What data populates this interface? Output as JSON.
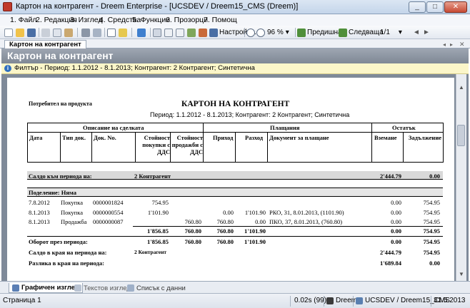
{
  "window": {
    "title": "Картон на контрагент - Dreem Enterprise - [UCSDEV / Dreem15_CMS (Dreem)]"
  },
  "menu": [
    "1. Файл",
    "2. Редакция",
    "3. Изглед",
    "4. Средства",
    "5. Функции",
    "6. Прозорци",
    "7. Помощ"
  ],
  "toolbar": {
    "settings_label": "Настройки...",
    "zoom": "96 %",
    "prev_label": "Предишна",
    "next_label": "Следваща",
    "page": "1/1"
  },
  "tab": {
    "label": "Картон на контрагент"
  },
  "header": {
    "title": "Картон на контрагент"
  },
  "filter": {
    "text": "Филтър - Период: 1.1.2012 - 8.1.2013; Контрагент: 2 Контрагент; Синтетична"
  },
  "report": {
    "consumer": "Потребител на продукта",
    "title": "КАРТОН НА КОНТРАГЕНТ",
    "subtitle": "Период: 1.1.2012 - 8.1.2013; Контрагент: 2 Контрагент; Синтетична",
    "group_headers": {
      "description": "Описание на сделката",
      "payments": "Плащания",
      "balances": "Остатък"
    },
    "columns": {
      "date": "Дата",
      "doc_type": "Тип док.",
      "doc_no": "Док. No.",
      "buy_value": "Стойност покупки с ДДС",
      "sell_value": "Стойност продажби с ДДС",
      "income": "Приход",
      "expense": "Разход",
      "payment_doc": "Документ за плащане",
      "receivable": "Вземане",
      "liability": "Задължение"
    },
    "opening": {
      "label": "Салдо към периода на:",
      "counterparty": "2 Контрагент",
      "receivable": "2'444.79",
      "liability": "0.00"
    },
    "division": "Поделение: Няма",
    "rows": [
      {
        "date": "7.8.2012",
        "type": "Покупка",
        "no": "0000001824",
        "buy": "754.95",
        "sell": "",
        "income": "",
        "expense": "",
        "paydoc": "",
        "receivable": "0.00",
        "liability": "754.95"
      },
      {
        "date": "8.1.2013",
        "type": "Покупка",
        "no": "0000000554",
        "buy": "1'101.90",
        "sell": "",
        "income": "0.00",
        "expense": "1'101.90",
        "paydoc": "РКО, 31, 8.01.2013, (1101.90)",
        "receivable": "0.00",
        "liability": "754.95"
      },
      {
        "date": "8.1.2013",
        "type": "Продажба",
        "no": "0000000087",
        "buy": "",
        "sell": "760.80",
        "income": "760.80",
        "expense": "0.00",
        "paydoc": "ПКО, 37, 8.01.2013, (760.80)",
        "receivable": "0.00",
        "liability": "754.95"
      }
    ],
    "subtotal": {
      "buy": "1'856.85",
      "sell": "760.80",
      "income": "760.80",
      "expense": "1'101.90",
      "receivable": "0.00",
      "liability": "754.95"
    },
    "turnover": {
      "label": "Оборот през периода:",
      "buy": "1'856.85",
      "sell": "760.80",
      "income": "760.80",
      "expense": "1'101.90",
      "receivable": "0.00",
      "liability": "754.95"
    },
    "closing": {
      "label": "Салдо в края на периода на:",
      "counterparty": "2 Контрагент",
      "receivable": "2'444.79",
      "liability": "754.95"
    },
    "difference": {
      "label": "Разлика в края на периода:",
      "receivable": "1'689.84",
      "liability": "0.00"
    }
  },
  "bottom_tabs": [
    "Графичен изглед",
    "Текстов изглед",
    "Списък с данни"
  ],
  "status": {
    "page": "Страница 1",
    "time": "0.02s (99)",
    "app": "Dreem",
    "db": "UCSDEV / Dreem15_CMS",
    "date": "31.5.2013"
  }
}
